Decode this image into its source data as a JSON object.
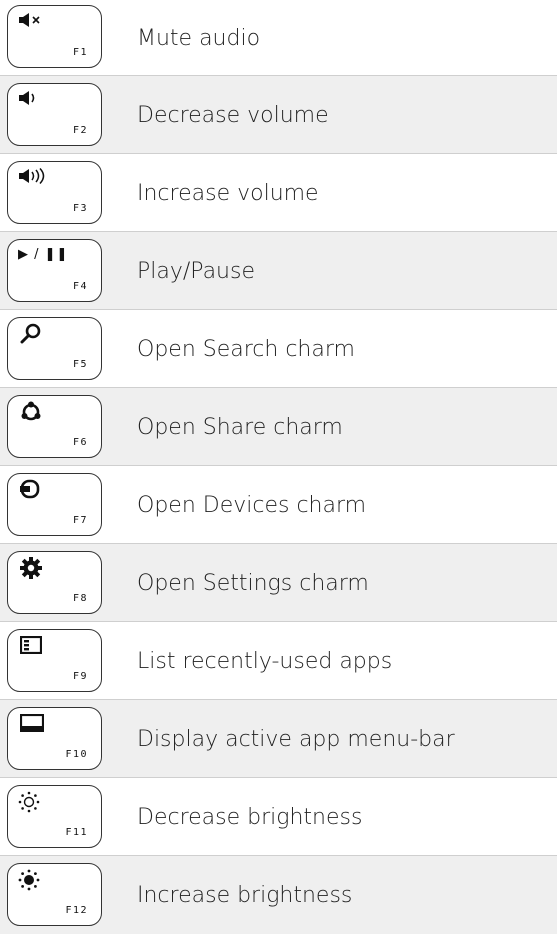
{
  "rows": [
    {
      "fn": "F1",
      "label": "Mute audio",
      "icon": "mute-icon"
    },
    {
      "fn": "F2",
      "label": "Decrease volume",
      "icon": "volume-low-icon"
    },
    {
      "fn": "F3",
      "label": "Increase volume",
      "icon": "volume-high-icon"
    },
    {
      "fn": "F4",
      "label": "Play/Pause",
      "icon": "play-pause-icon",
      "glyph": "▶ / ❚❚"
    },
    {
      "fn": "F5",
      "label": "Open Search charm",
      "icon": "search-icon"
    },
    {
      "fn": "F6",
      "label": "Open Share charm",
      "icon": "share-icon"
    },
    {
      "fn": "F7",
      "label": "Open Devices charm",
      "icon": "devices-icon"
    },
    {
      "fn": "F8",
      "label": "Open Settings charm",
      "icon": "gear-icon"
    },
    {
      "fn": "F9",
      "label": "List recently-used apps",
      "icon": "recent-apps-icon"
    },
    {
      "fn": "F10",
      "label": "Display active app menu-bar",
      "icon": "app-bar-icon"
    },
    {
      "fn": "F11",
      "label": "Decrease brightness",
      "icon": "brightness-low-icon"
    },
    {
      "fn": "F12",
      "label": "Increase brightness",
      "icon": "brightness-high-icon"
    }
  ],
  "colors": {
    "shaded_row": "#efefef",
    "key_border": "#333333",
    "text": "#222222"
  }
}
